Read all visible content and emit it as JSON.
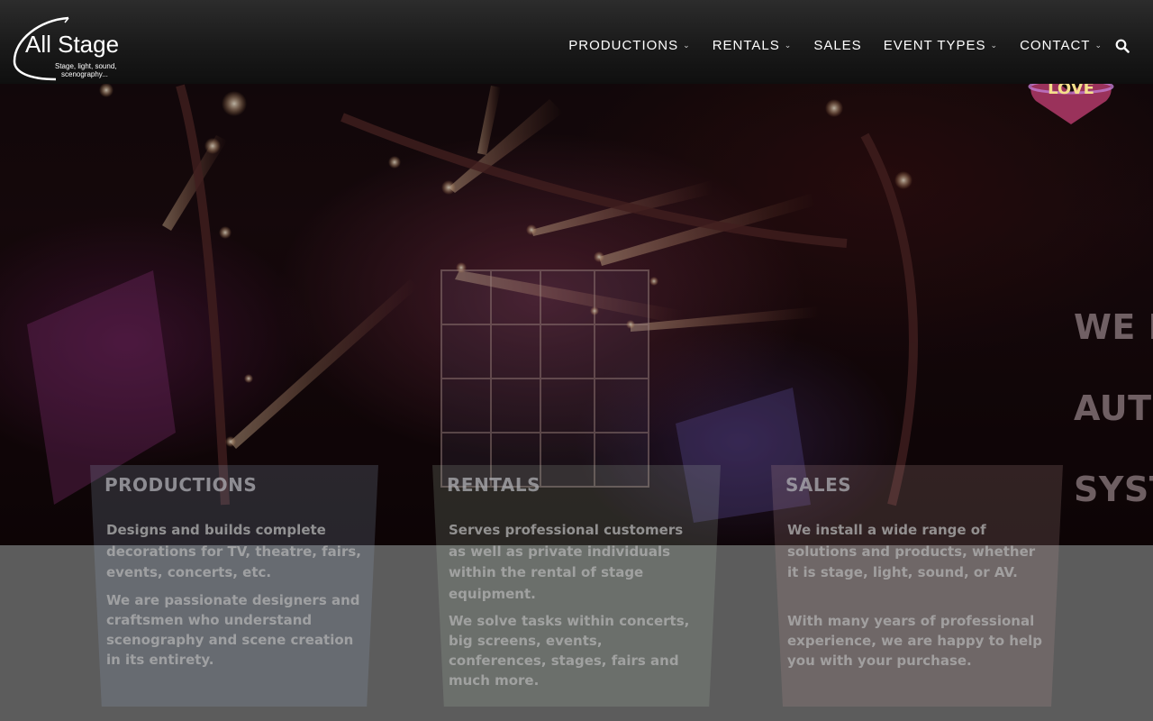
{
  "brand": {
    "name": "All Stage",
    "tagline_line1": "Stage, light, sound,",
    "tagline_line2": "scenography..."
  },
  "nav": {
    "items": [
      {
        "label": "PRODUCTIONS",
        "has_dropdown": true
      },
      {
        "label": "RENTALS",
        "has_dropdown": true
      },
      {
        "label": "SALES",
        "has_dropdown": false
      },
      {
        "label": "EVENT TYPES",
        "has_dropdown": true
      },
      {
        "label": "CONTACT",
        "has_dropdown": true
      }
    ],
    "search_icon": "search-icon"
  },
  "hero": {
    "caption_line1": "WE B",
    "caption_line2": "AUTO",
    "caption_line3": "SYST",
    "badge_text": "LOVE"
  },
  "cards": [
    {
      "title": "PRODUCTIONS",
      "p1": "Designs and builds complete decorations for TV, theatre, fairs, events, concerts, etc.",
      "p2": "We are passionate designers and craftsmen who understand scenography and scene creation in its entirety."
    },
    {
      "title": "RENTALS",
      "p1": "Serves professional customers as well as private individuals within the rental of stage equipment.",
      "p2": "We solve tasks within concerts, big screens, events, conferences, stages, fairs and much more."
    },
    {
      "title": "SALES",
      "p1": "We install a wide range of solutions and products, whether it is stage, light, sound, or AV.",
      "p2": "With many years of professional experience, we are happy to help you with your purchase."
    }
  ],
  "colors": {
    "header_bg": "#1a1a1a",
    "nav_text": "#ffffff",
    "lower_bg": "#5c5c5c"
  }
}
